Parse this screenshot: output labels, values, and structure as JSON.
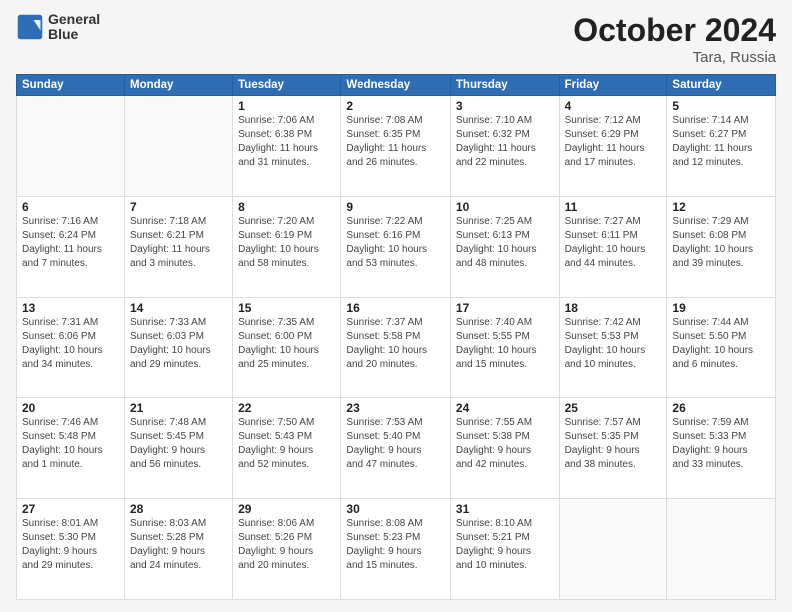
{
  "header": {
    "logo_line1": "General",
    "logo_line2": "Blue",
    "month": "October 2024",
    "location": "Tara, Russia"
  },
  "weekdays": [
    "Sunday",
    "Monday",
    "Tuesday",
    "Wednesday",
    "Thursday",
    "Friday",
    "Saturday"
  ],
  "weeks": [
    [
      {
        "day": "",
        "info": ""
      },
      {
        "day": "",
        "info": ""
      },
      {
        "day": "1",
        "info": "Sunrise: 7:06 AM\nSunset: 6:38 PM\nDaylight: 11 hours\nand 31 minutes."
      },
      {
        "day": "2",
        "info": "Sunrise: 7:08 AM\nSunset: 6:35 PM\nDaylight: 11 hours\nand 26 minutes."
      },
      {
        "day": "3",
        "info": "Sunrise: 7:10 AM\nSunset: 6:32 PM\nDaylight: 11 hours\nand 22 minutes."
      },
      {
        "day": "4",
        "info": "Sunrise: 7:12 AM\nSunset: 6:29 PM\nDaylight: 11 hours\nand 17 minutes."
      },
      {
        "day": "5",
        "info": "Sunrise: 7:14 AM\nSunset: 6:27 PM\nDaylight: 11 hours\nand 12 minutes."
      }
    ],
    [
      {
        "day": "6",
        "info": "Sunrise: 7:16 AM\nSunset: 6:24 PM\nDaylight: 11 hours\nand 7 minutes."
      },
      {
        "day": "7",
        "info": "Sunrise: 7:18 AM\nSunset: 6:21 PM\nDaylight: 11 hours\nand 3 minutes."
      },
      {
        "day": "8",
        "info": "Sunrise: 7:20 AM\nSunset: 6:19 PM\nDaylight: 10 hours\nand 58 minutes."
      },
      {
        "day": "9",
        "info": "Sunrise: 7:22 AM\nSunset: 6:16 PM\nDaylight: 10 hours\nand 53 minutes."
      },
      {
        "day": "10",
        "info": "Sunrise: 7:25 AM\nSunset: 6:13 PM\nDaylight: 10 hours\nand 48 minutes."
      },
      {
        "day": "11",
        "info": "Sunrise: 7:27 AM\nSunset: 6:11 PM\nDaylight: 10 hours\nand 44 minutes."
      },
      {
        "day": "12",
        "info": "Sunrise: 7:29 AM\nSunset: 6:08 PM\nDaylight: 10 hours\nand 39 minutes."
      }
    ],
    [
      {
        "day": "13",
        "info": "Sunrise: 7:31 AM\nSunset: 6:06 PM\nDaylight: 10 hours\nand 34 minutes."
      },
      {
        "day": "14",
        "info": "Sunrise: 7:33 AM\nSunset: 6:03 PM\nDaylight: 10 hours\nand 29 minutes."
      },
      {
        "day": "15",
        "info": "Sunrise: 7:35 AM\nSunset: 6:00 PM\nDaylight: 10 hours\nand 25 minutes."
      },
      {
        "day": "16",
        "info": "Sunrise: 7:37 AM\nSunset: 5:58 PM\nDaylight: 10 hours\nand 20 minutes."
      },
      {
        "day": "17",
        "info": "Sunrise: 7:40 AM\nSunset: 5:55 PM\nDaylight: 10 hours\nand 15 minutes."
      },
      {
        "day": "18",
        "info": "Sunrise: 7:42 AM\nSunset: 5:53 PM\nDaylight: 10 hours\nand 10 minutes."
      },
      {
        "day": "19",
        "info": "Sunrise: 7:44 AM\nSunset: 5:50 PM\nDaylight: 10 hours\nand 6 minutes."
      }
    ],
    [
      {
        "day": "20",
        "info": "Sunrise: 7:46 AM\nSunset: 5:48 PM\nDaylight: 10 hours\nand 1 minute."
      },
      {
        "day": "21",
        "info": "Sunrise: 7:48 AM\nSunset: 5:45 PM\nDaylight: 9 hours\nand 56 minutes."
      },
      {
        "day": "22",
        "info": "Sunrise: 7:50 AM\nSunset: 5:43 PM\nDaylight: 9 hours\nand 52 minutes."
      },
      {
        "day": "23",
        "info": "Sunrise: 7:53 AM\nSunset: 5:40 PM\nDaylight: 9 hours\nand 47 minutes."
      },
      {
        "day": "24",
        "info": "Sunrise: 7:55 AM\nSunset: 5:38 PM\nDaylight: 9 hours\nand 42 minutes."
      },
      {
        "day": "25",
        "info": "Sunrise: 7:57 AM\nSunset: 5:35 PM\nDaylight: 9 hours\nand 38 minutes."
      },
      {
        "day": "26",
        "info": "Sunrise: 7:59 AM\nSunset: 5:33 PM\nDaylight: 9 hours\nand 33 minutes."
      }
    ],
    [
      {
        "day": "27",
        "info": "Sunrise: 8:01 AM\nSunset: 5:30 PM\nDaylight: 9 hours\nand 29 minutes."
      },
      {
        "day": "28",
        "info": "Sunrise: 8:03 AM\nSunset: 5:28 PM\nDaylight: 9 hours\nand 24 minutes."
      },
      {
        "day": "29",
        "info": "Sunrise: 8:06 AM\nSunset: 5:26 PM\nDaylight: 9 hours\nand 20 minutes."
      },
      {
        "day": "30",
        "info": "Sunrise: 8:08 AM\nSunset: 5:23 PM\nDaylight: 9 hours\nand 15 minutes."
      },
      {
        "day": "31",
        "info": "Sunrise: 8:10 AM\nSunset: 5:21 PM\nDaylight: 9 hours\nand 10 minutes."
      },
      {
        "day": "",
        "info": ""
      },
      {
        "day": "",
        "info": ""
      }
    ]
  ]
}
